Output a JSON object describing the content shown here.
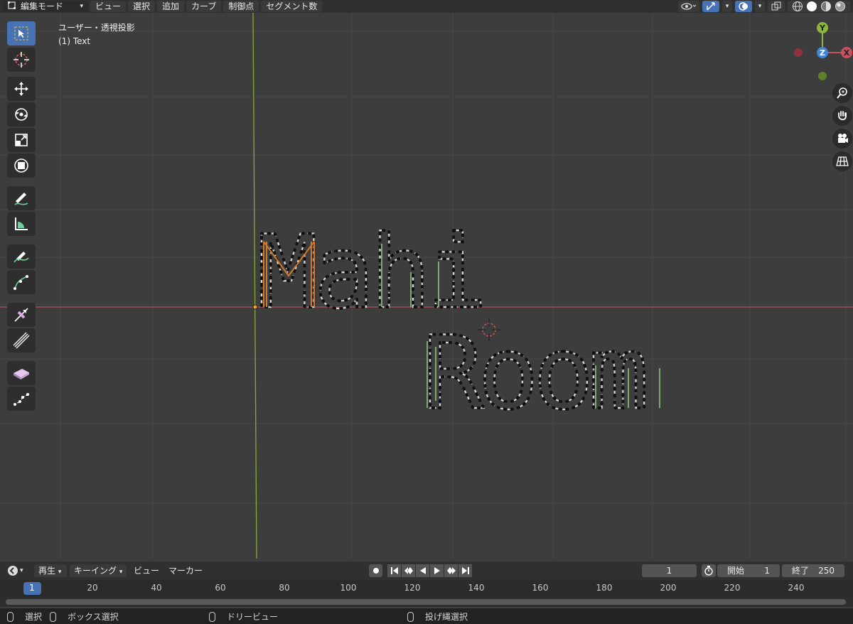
{
  "header": {
    "mode": "編集モード",
    "menus": [
      "ビュー",
      "選択",
      "追加",
      "カーブ",
      "制御点",
      "セグメント数"
    ]
  },
  "viewport": {
    "view_label": "ユーザー・透視投影",
    "object_label": "(1) Text",
    "text_line1": "Mahi",
    "text_line2": "Room"
  },
  "gizmo": {
    "y": "Y",
    "z": "Z",
    "x": "X"
  },
  "timeline": {
    "menus": [
      "再生",
      "キーイング",
      "ビュー",
      "マーカー"
    ],
    "current_frame": "1",
    "start_label": "開始",
    "start_value": "1",
    "end_label": "終了",
    "end_value": "250",
    "ruler": [
      "1",
      "20",
      "40",
      "60",
      "80",
      "100",
      "120",
      "140",
      "160",
      "180",
      "200",
      "220",
      "240"
    ]
  },
  "status": {
    "select": "選択",
    "box_select": "ボックス選択",
    "dolly": "ドリービュー",
    "lasso": "投げ縄選択"
  },
  "colors": {
    "accent": "#4772b3",
    "x_axis": "#c9515f",
    "y_axis": "#8cb63f",
    "z_axis": "#3f86d8",
    "orange_curve": "#d17a29",
    "green_curve": "#7fa86a"
  }
}
